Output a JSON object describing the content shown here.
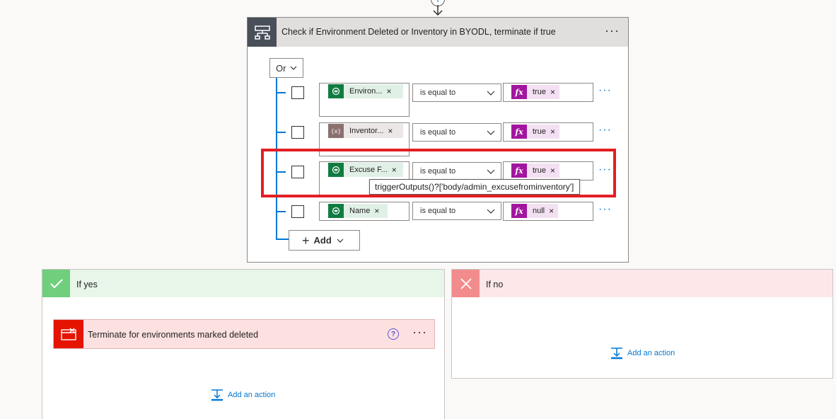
{
  "condition": {
    "title": "Check if Environment Deleted or Inventory in BYODL, terminate if true",
    "group_operator": "Or",
    "rows": [
      {
        "left_token": "Environ...",
        "left_icon": "dataverse-icon",
        "operator": "is equal to",
        "right_token": "true"
      },
      {
        "left_token": "Inventor...",
        "left_icon": "variable-icon",
        "operator": "is equal to",
        "right_token": "true"
      },
      {
        "left_token": "Excuse F...",
        "left_icon": "dataverse-icon",
        "operator": "is equal to",
        "right_token": "true"
      },
      {
        "left_token": "Name",
        "left_icon": "dataverse-icon",
        "operator": "is equal to",
        "right_token": "null"
      }
    ],
    "tooltip": "triggerOutputs()?['body/admin_excusefrominventory']",
    "add_label": "Add",
    "fx_label": "fx",
    "remove_glyph": "×"
  },
  "if_yes": {
    "label": "If yes",
    "action_title": "Terminate for environments marked deleted",
    "help_glyph": "?",
    "add_action_label": "Add an action"
  },
  "if_no": {
    "label": "If no",
    "add_action_label": "Add an action"
  },
  "colors": {
    "highlight": "#e31e24",
    "accent": "#0078d4",
    "dataverse_green": "#107c41",
    "fx_purple": "#a2169f",
    "terminate_red": "#e51400"
  }
}
